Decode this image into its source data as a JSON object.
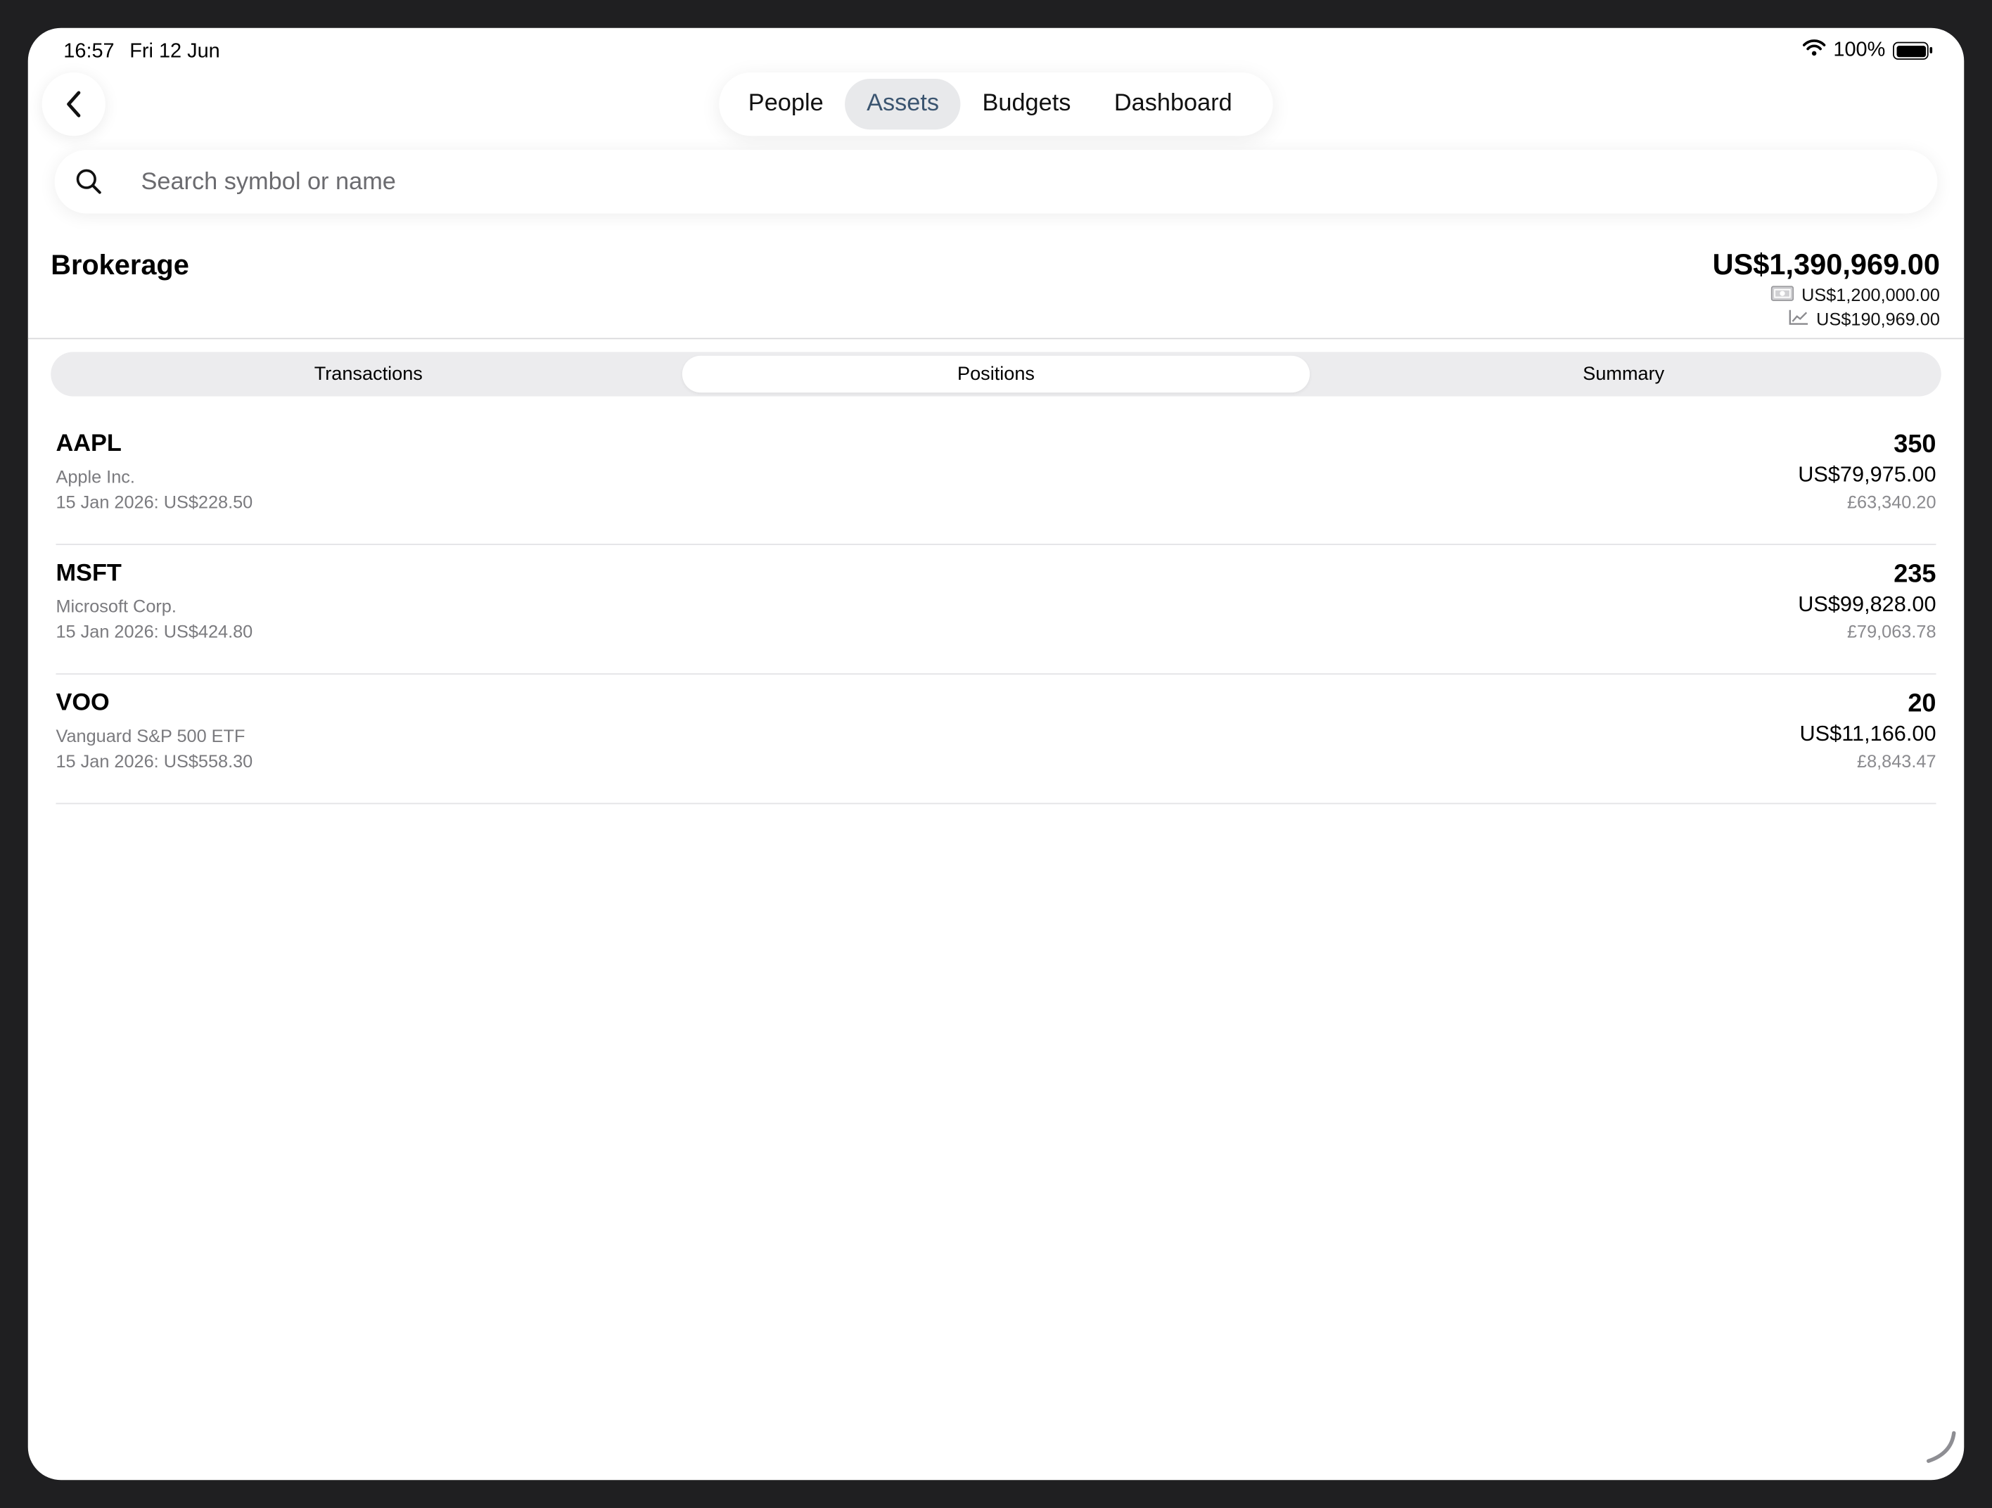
{
  "status_bar": {
    "time": "16:57",
    "date": "Fri 12 Jun",
    "battery": "100%"
  },
  "nav": {
    "back_icon": "chevron-left-icon",
    "tabs": [
      {
        "label": "People"
      },
      {
        "label": "Assets"
      },
      {
        "label": "Budgets"
      },
      {
        "label": "Dashboard"
      }
    ],
    "active_tab": "Assets"
  },
  "search": {
    "placeholder": "Search symbol or name",
    "value": ""
  },
  "account": {
    "title": "Brokerage",
    "total": "US$1,390,969.00",
    "cash": "US$1,200,000.00",
    "investments": "US$190,969.00",
    "cash_icon": "banknote-icon",
    "investments_icon": "chart-line-icon"
  },
  "segments": {
    "items": [
      {
        "label": "Transactions"
      },
      {
        "label": "Positions"
      },
      {
        "label": "Summary"
      }
    ],
    "active": "Positions"
  },
  "positions": [
    {
      "symbol": "AAPL",
      "name": "Apple Inc.",
      "price_line": "15 Jan 2026:  US$228.50",
      "quantity": "350",
      "value_usd": "US$79,975.00",
      "value_gbp": "£63,340.20"
    },
    {
      "symbol": "MSFT",
      "name": "Microsoft Corp.",
      "price_line": "15 Jan 2026:  US$424.80",
      "quantity": "235",
      "value_usd": "US$99,828.00",
      "value_gbp": "£79,063.78"
    },
    {
      "symbol": "VOO",
      "name": "Vanguard S&P 500 ETF",
      "price_line": "15 Jan 2026:  US$558.30",
      "quantity": "20",
      "value_usd": "US$11,166.00",
      "value_gbp": "£8,843.47"
    }
  ],
  "colors": {
    "active_tab_text": "#3b5570",
    "active_tab_bg": "#e8e9eb",
    "bezel": "#1f1f21"
  }
}
